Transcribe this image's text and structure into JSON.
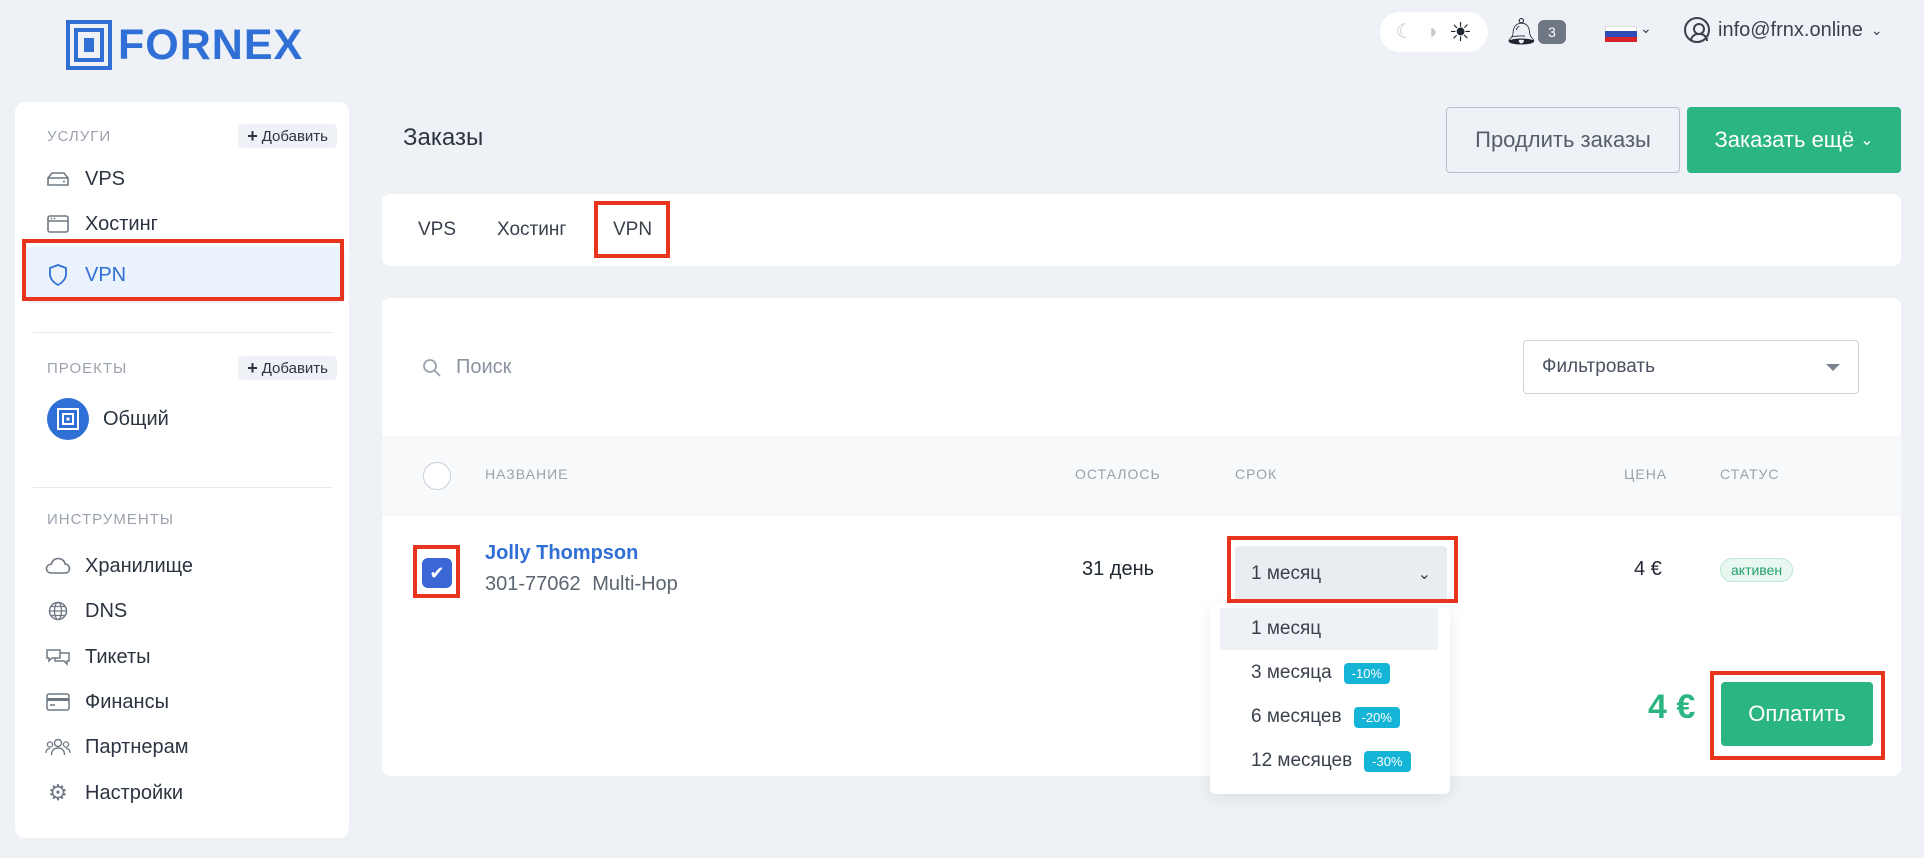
{
  "brand": {
    "name": "FORNEX"
  },
  "header": {
    "theme_icons": [
      "moon-icon",
      "auto-theme-icon",
      "sun-icon"
    ],
    "notifications_count": "3",
    "language_flag": "ru-flag-icon",
    "user_email": "info@frnx.online"
  },
  "sidebar": {
    "services": {
      "title": "Услуги",
      "add_label": "Добавить",
      "items": [
        {
          "label": "VPS",
          "icon": "server-icon"
        },
        {
          "label": "Хостинг",
          "icon": "browser-window-icon"
        },
        {
          "label": "VPN",
          "icon": "shield-icon",
          "active": true
        }
      ]
    },
    "projects": {
      "title": "Проекты",
      "add_label": "Добавить",
      "items": [
        {
          "label": "Общий",
          "icon": "project-avatar-icon"
        }
      ]
    },
    "tools": {
      "title": "Инструменты",
      "items": [
        {
          "label": "Хранилище",
          "icon": "cloud-icon"
        },
        {
          "label": "DNS",
          "icon": "globe-icon"
        },
        {
          "label": "Тикеты",
          "icon": "chat-icon"
        },
        {
          "label": "Финансы",
          "icon": "credit-card-icon"
        },
        {
          "label": "Партнерам",
          "icon": "users-icon"
        },
        {
          "label": "Настройки",
          "icon": "gear-icon"
        }
      ]
    }
  },
  "main": {
    "title": "Заказы",
    "extend_label": "Продлить заказы",
    "order_more_label": "Заказать ещё",
    "tabs": [
      {
        "label": "VPS"
      },
      {
        "label": "Хостинг"
      },
      {
        "label": "VPN",
        "active": true
      }
    ],
    "search_placeholder": "Поиск",
    "filter_label": "Фильтровать",
    "columns": {
      "name": "Название",
      "remaining": "Осталось",
      "period": "Срок",
      "price": "Цена",
      "status": "Статус"
    },
    "row": {
      "checked": true,
      "name": "Jolly Thompson",
      "id": "301-77062",
      "type": "Multi-Hop",
      "remaining": "31 день",
      "period": "1 месяц",
      "price": "4 €",
      "status": "активен"
    },
    "period_options": [
      {
        "label": "1 месяц",
        "discount": "",
        "selected": true
      },
      {
        "label": "3 месяца",
        "discount": "-10%"
      },
      {
        "label": "6 месяцев",
        "discount": "-20%"
      },
      {
        "label": "12 месяцев",
        "discount": "-30%"
      }
    ],
    "total": "4 €",
    "pay_label": "Оплатить"
  },
  "colors": {
    "brand_blue": "#2f6fd6",
    "accent_green": "#2bb582",
    "discount_cyan": "#14b4d6",
    "highlight_red": "#e8341c"
  }
}
